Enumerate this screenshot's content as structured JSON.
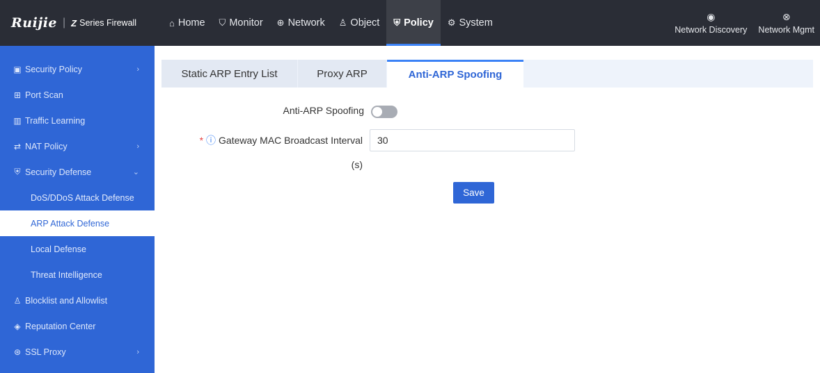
{
  "header": {
    "brand": "Ruijie",
    "product_mark": "Z",
    "product": "Series Firewall",
    "nav": [
      {
        "label": "Home",
        "icon": "home-icon",
        "glyph": "⌂"
      },
      {
        "label": "Monitor",
        "icon": "shield-check-icon",
        "glyph": "⛉"
      },
      {
        "label": "Network",
        "icon": "globe-icon",
        "glyph": "⊕"
      },
      {
        "label": "Object",
        "icon": "user-list-icon",
        "glyph": "♙"
      },
      {
        "label": "Policy",
        "icon": "policy-icon",
        "glyph": "⛨",
        "active": true
      },
      {
        "label": "System",
        "icon": "gear-icon",
        "glyph": "⚙"
      }
    ],
    "tools": [
      {
        "label": "Network Discovery",
        "icon": "wifi-signal-icon",
        "glyph": "◉"
      },
      {
        "label": "Network Mgmt",
        "icon": "network-mgmt-icon",
        "glyph": "⊗"
      }
    ]
  },
  "sidebar": {
    "items": [
      {
        "label": "Security Policy",
        "icon": "security-policy-icon",
        "glyph": "▣",
        "chevron": "›"
      },
      {
        "label": "Port Scan",
        "icon": "port-scan-icon",
        "glyph": "⊞"
      },
      {
        "label": "Traffic Learning",
        "icon": "traffic-chart-icon",
        "glyph": "▥"
      },
      {
        "label": "NAT Policy",
        "icon": "nat-icon",
        "glyph": "⇄",
        "chevron": "›"
      },
      {
        "label": "Security Defense",
        "icon": "security-defense-icon",
        "glyph": "⛨",
        "chevron": "⌄"
      },
      {
        "label": "DoS/DDoS Attack Defense",
        "sub": true
      },
      {
        "label": "ARP Attack Defense",
        "sub": true,
        "active": true
      },
      {
        "label": "Local Defense",
        "sub": true
      },
      {
        "label": "Threat Intelligence",
        "sub": true
      },
      {
        "label": "Blocklist and Allowlist",
        "icon": "users-icon",
        "glyph": "♙"
      },
      {
        "label": "Reputation Center",
        "icon": "reputation-icon",
        "glyph": "◈"
      },
      {
        "label": "SSL Proxy",
        "icon": "ssl-proxy-icon",
        "glyph": "⊛",
        "chevron": "›"
      }
    ]
  },
  "tabs": [
    {
      "label": "Static ARP Entry List"
    },
    {
      "label": "Proxy ARP"
    },
    {
      "label": "Anti-ARP Spoofing",
      "active": true
    }
  ],
  "form": {
    "toggle_label": "Anti-ARP Spoofing",
    "toggle_on": false,
    "required_mark": "*",
    "info_glyph": "ⓘ",
    "interval_label": "Gateway MAC Broadcast Interval",
    "interval_unit": "(s)",
    "interval_value": "30",
    "save_label": "Save"
  }
}
